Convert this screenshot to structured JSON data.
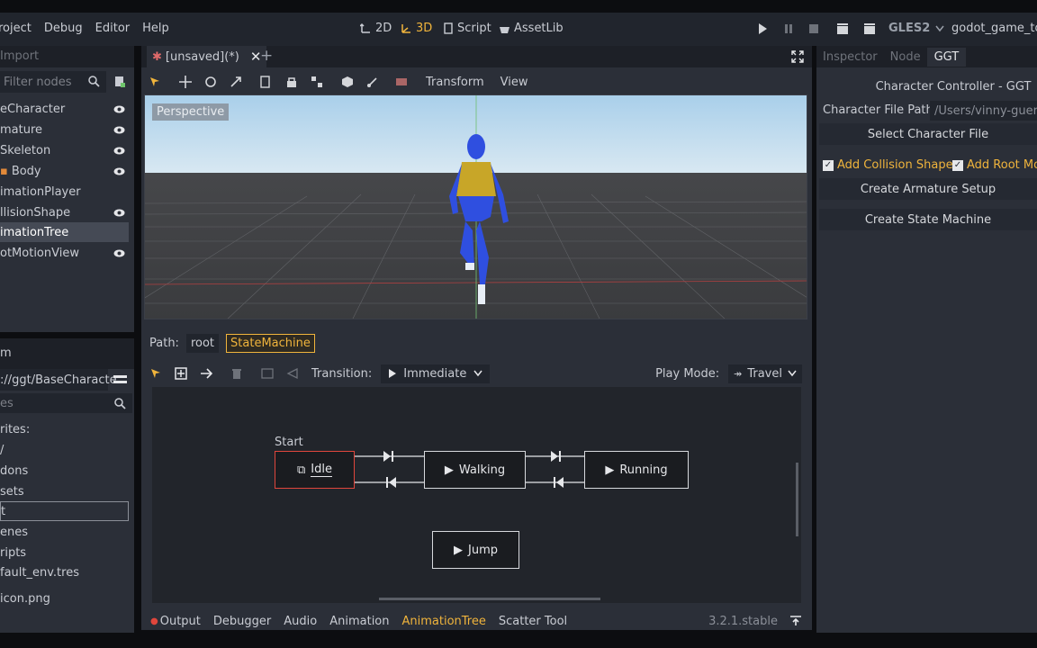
{
  "menu": {
    "items": [
      "roject",
      "Debug",
      "Editor",
      "Help"
    ]
  },
  "modes": {
    "two_d": "2D",
    "three_d": "3D",
    "script": "Script",
    "assetlib": "AssetLib"
  },
  "renderer": "GLES2",
  "project_name": "godot_game_too",
  "scene_dock": {
    "import_tab": "Import",
    "filter_placeholder": "Filter nodes",
    "nodes": [
      {
        "label": "eCharacter",
        "visible_toggle": true
      },
      {
        "label": "mature",
        "visible_toggle": true
      },
      {
        "label": "Skeleton",
        "visible_toggle": true
      },
      {
        "label": "Body",
        "visible_toggle": true
      },
      {
        "label": "imationPlayer",
        "visible_toggle": false
      },
      {
        "label": "llisionShape",
        "visible_toggle": true
      },
      {
        "label": "imationTree",
        "visible_toggle": false,
        "selected": true
      },
      {
        "label": "otMotionView",
        "visible_toggle": true
      }
    ]
  },
  "filesystem": {
    "tab": "m",
    "path": "://ggt/BaseCharacte",
    "search_placeholder": "es",
    "items": [
      "rites:",
      "/",
      "dons",
      "sets",
      "t",
      "enes",
      "ripts",
      "fault_env.tres",
      "icon.png"
    ]
  },
  "scene_tab": {
    "label": "[unsaved](*)"
  },
  "viewport_toolbar": {
    "transform": "Transform",
    "view": "View"
  },
  "viewport": {
    "perspective_label": "Perspective"
  },
  "animtree": {
    "path_label": "Path:",
    "crumbs": [
      "root",
      "StateMachine"
    ],
    "transition_label": "Transition:",
    "transition_value": "Immediate",
    "playmode_label": "Play Mode:",
    "playmode_value": "Travel",
    "start_label": "Start",
    "states": {
      "idle": "Idle",
      "walking": "Walking",
      "running": "Running",
      "jump": "Jump"
    }
  },
  "bottom_tabs": [
    "Output",
    "Debugger",
    "Audio",
    "Animation",
    "AnimationTree",
    "Scatter Tool"
  ],
  "version": "3.2.1.stable",
  "right_dock": {
    "tabs": [
      "Inspector",
      "Node",
      "GGT"
    ],
    "title": "Character Controller - GGT",
    "file_path_label": "Character File Path",
    "file_path_value": "/Users/vinny-guerre",
    "select_file": "Select Character File",
    "add_collision": "Add Collision Shape",
    "add_root_motion": "Add Root Mo",
    "create_armature": "Create Armature Setup",
    "create_state_machine": "Create State Machine"
  },
  "colors": {
    "accent": "#f0b43c",
    "active_3d": "#f0b43c",
    "selection_border": "#e0463c"
  }
}
